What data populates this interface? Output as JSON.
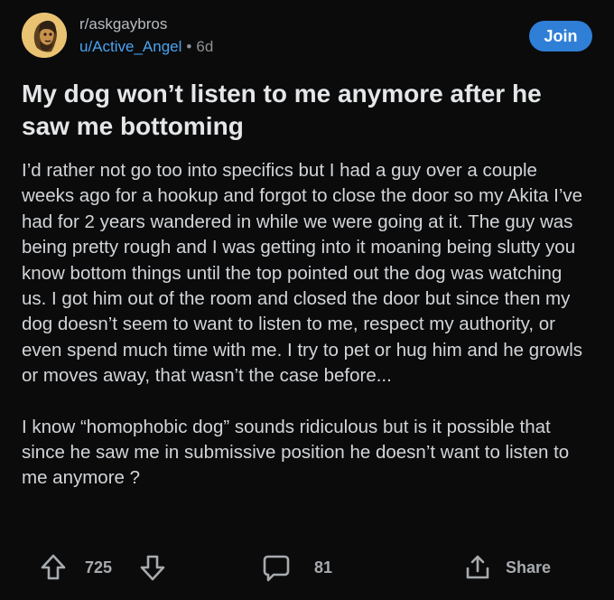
{
  "post": {
    "subreddit": "r/askgaybros",
    "username": "u/Active_Angel",
    "separator": "•",
    "age": "6d",
    "join_label": "Join",
    "title": "My dog won’t listen to me anymore after he saw me bottoming",
    "paragraphs": [
      "I’d rather not go too into specifics but I had a guy over a couple weeks ago for a hookup and forgot to close the door so my Akita I’ve had for 2 years wandered in while we were going at it. The guy was being pretty rough and I was getting into it moaning being slutty you know bottom things until the top pointed out the dog was watching us. I got him out of the room and closed the door but since then my dog doesn’t seem to want to listen to me, respect my authority, or even spend much time with me. I try to pet or hug him and he growls or moves away, that wasn’t the case before...",
      "I know “homophobic dog” sounds ridiculous but is it possible that since he saw me in  submissive position  he doesn’t want to listen to me anymore ?"
    ]
  },
  "actions": {
    "vote_count": "725",
    "comment_count": "81",
    "share_label": "Share"
  },
  "icons": {
    "upvote": "upvote-arrow-icon",
    "downvote": "downvote-arrow-icon",
    "comment": "comment-bubble-icon",
    "share": "share-upload-icon"
  },
  "colors": {
    "background": "#0b0b0c",
    "join_button": "#2f7fd6",
    "username": "#4aa3f0",
    "avatar": "#e9c372"
  }
}
